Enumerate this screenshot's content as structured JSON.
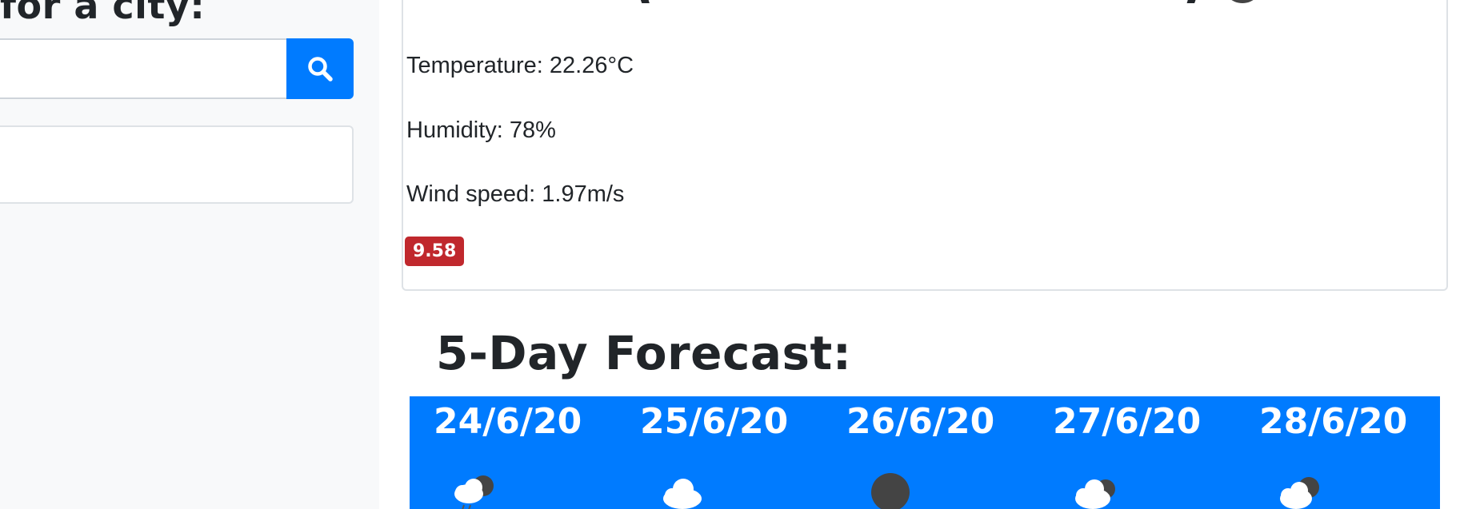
{
  "sidebar": {
    "title": "for a city:",
    "search_placeholder": "",
    "search_icon": "search-icon"
  },
  "current": {
    "temperature": "Temperature: 22.26°C",
    "humidity": "Humidity: 78%",
    "wind": "Wind speed: 1.97m/s",
    "uv_index": "9.58",
    "uv_color": "#c0282d"
  },
  "forecast": {
    "title": "5-Day Forecast:",
    "accent": "#007bff",
    "days": [
      {
        "date": "24/6/20",
        "icon": "rain-cloud-icon"
      },
      {
        "date": "25/6/20",
        "icon": "cloud-icon"
      },
      {
        "date": "26/6/20",
        "icon": "dark-circle-icon"
      },
      {
        "date": "27/6/20",
        "icon": "dark-cloud-icon"
      },
      {
        "date": "28/6/20",
        "icon": "partly-cloudy-icon"
      }
    ]
  }
}
